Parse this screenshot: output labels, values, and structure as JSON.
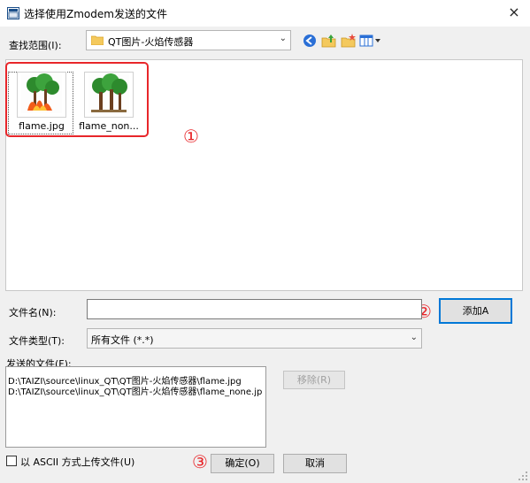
{
  "window": {
    "title": "选择使用Zmodem发送的文件",
    "close_glyph": "×"
  },
  "lookin": {
    "label": "查找范围(I):",
    "value": "QT图片-火焰传感器",
    "toolbar_icons": [
      "back-icon",
      "up-folder-icon",
      "new-folder-icon",
      "view-menu-icon"
    ]
  },
  "files": [
    {
      "name": "flame.jpg",
      "selected": true
    },
    {
      "name": "flame_non..."
    }
  ],
  "annotations": {
    "mark1": "①",
    "mark2": "②",
    "mark3": "③",
    "color": "#e8262a"
  },
  "filename": {
    "label": "文件名(N):",
    "value": ""
  },
  "add_button": "添加A",
  "filetype": {
    "label": "文件类型(T):",
    "value": "所有文件 (*.*)"
  },
  "sent": {
    "label": "发送的文件(F):",
    "items": [
      "D:\\TAIZI\\source\\linux_QT\\QT图片-火焰传感器\\flame.jpg",
      "D:\\TAIZI\\source\\linux_QT\\QT图片-火焰传感器\\flame_none.jp"
    ]
  },
  "remove_button": "移除(R)",
  "ascii_checkbox": {
    "label": "以 ASCII 方式上传文件(U)",
    "checked": false
  },
  "ok_button": "确定(O)",
  "cancel_button": "取消"
}
